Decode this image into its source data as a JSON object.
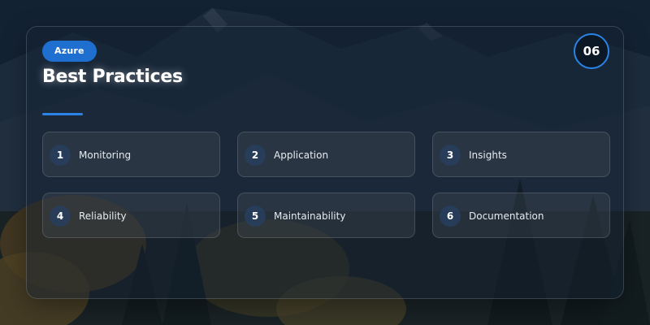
{
  "slide": {
    "badge": "Azure",
    "title": "Best Practices",
    "page_number": "06",
    "accent_color": "#2a83e6",
    "badge_color": "#1f6fd1"
  },
  "items": [
    {
      "number": "1",
      "label": "Monitoring"
    },
    {
      "number": "2",
      "label": "Application"
    },
    {
      "number": "3",
      "label": "Insights"
    },
    {
      "number": "4",
      "label": "Reliability"
    },
    {
      "number": "5",
      "label": "Maintainability"
    },
    {
      "number": "6",
      "label": "Documentation"
    }
  ]
}
